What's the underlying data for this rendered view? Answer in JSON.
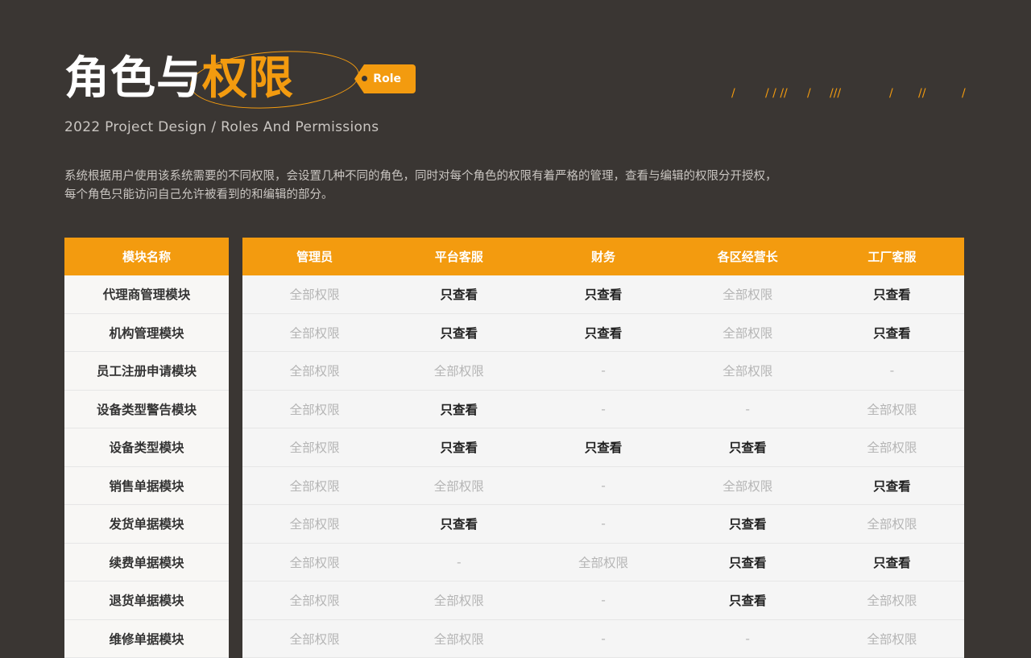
{
  "header": {
    "title_white": "角色与",
    "title_orange": "权限",
    "tag_label": "Role",
    "subtitle": "2022 Project Design / Roles And Permissions",
    "slashes": [
      "/",
      "/ / //",
      "/",
      "///",
      "/",
      "//",
      "/"
    ]
  },
  "description": [
    "系统根据用户使用该系统需要的不同权限，会设置几种不同的角色，同时对每个角色的权限有着严格的管理，查看与编辑的权限分开授权，",
    "每个角色只能访问自己允许被看到的和编辑的部分。"
  ],
  "table": {
    "module_header": "模块名称",
    "role_headers": [
      "管理员",
      "平台客服",
      "财务",
      "各区经营长",
      "工厂客服"
    ],
    "rows": [
      {
        "module": "代理商管理模块",
        "cells": [
          [
            "全部权限",
            "full"
          ],
          [
            "只查看",
            "view"
          ],
          [
            "只查看",
            "view"
          ],
          [
            "全部权限",
            "full"
          ],
          [
            "只查看",
            "view"
          ]
        ]
      },
      {
        "module": "机构管理模块",
        "cells": [
          [
            "全部权限",
            "full"
          ],
          [
            "只查看",
            "view"
          ],
          [
            "只查看",
            "view"
          ],
          [
            "全部权限",
            "full"
          ],
          [
            "只查看",
            "view"
          ]
        ]
      },
      {
        "module": "员工注册申请模块",
        "cells": [
          [
            "全部权限",
            "full"
          ],
          [
            "全部权限",
            "full"
          ],
          [
            "-",
            "none"
          ],
          [
            "全部权限",
            "full"
          ],
          [
            "-",
            "none"
          ]
        ]
      },
      {
        "module": "设备类型警告模块",
        "cells": [
          [
            "全部权限",
            "full"
          ],
          [
            "只查看",
            "view"
          ],
          [
            "-",
            "none"
          ],
          [
            "-",
            "none"
          ],
          [
            "全部权限",
            "full"
          ]
        ]
      },
      {
        "module": "设备类型模块",
        "cells": [
          [
            "全部权限",
            "full"
          ],
          [
            "只查看",
            "view"
          ],
          [
            "只查看",
            "view"
          ],
          [
            "只查看",
            "view"
          ],
          [
            "全部权限",
            "full"
          ]
        ]
      },
      {
        "module": "销售单据模块",
        "cells": [
          [
            "全部权限",
            "full"
          ],
          [
            "全部权限",
            "full"
          ],
          [
            "-",
            "none"
          ],
          [
            "全部权限",
            "full"
          ],
          [
            "只查看",
            "view"
          ]
        ]
      },
      {
        "module": "发货单据模块",
        "cells": [
          [
            "全部权限",
            "full"
          ],
          [
            "只查看",
            "view"
          ],
          [
            "-",
            "none"
          ],
          [
            "只查看",
            "view"
          ],
          [
            "全部权限",
            "full"
          ]
        ]
      },
      {
        "module": "续费单据模块",
        "cells": [
          [
            "全部权限",
            "full"
          ],
          [
            "-",
            "none"
          ],
          [
            "全部权限",
            "full"
          ],
          [
            "只查看",
            "view"
          ],
          [
            "只查看",
            "view"
          ]
        ]
      },
      {
        "module": "退货单据模块",
        "cells": [
          [
            "全部权限",
            "full"
          ],
          [
            "全部权限",
            "full"
          ],
          [
            "-",
            "none"
          ],
          [
            "只查看",
            "view"
          ],
          [
            "全部权限",
            "full"
          ]
        ]
      },
      {
        "module": "维修单据模块",
        "cells": [
          [
            "全部权限",
            "full"
          ],
          [
            "全部权限",
            "full"
          ],
          [
            "-",
            "none"
          ],
          [
            "-",
            "none"
          ],
          [
            "全部权限",
            "full"
          ]
        ]
      }
    ]
  },
  "colors": {
    "background": "#3a3633",
    "accent": "#f39b0f"
  }
}
